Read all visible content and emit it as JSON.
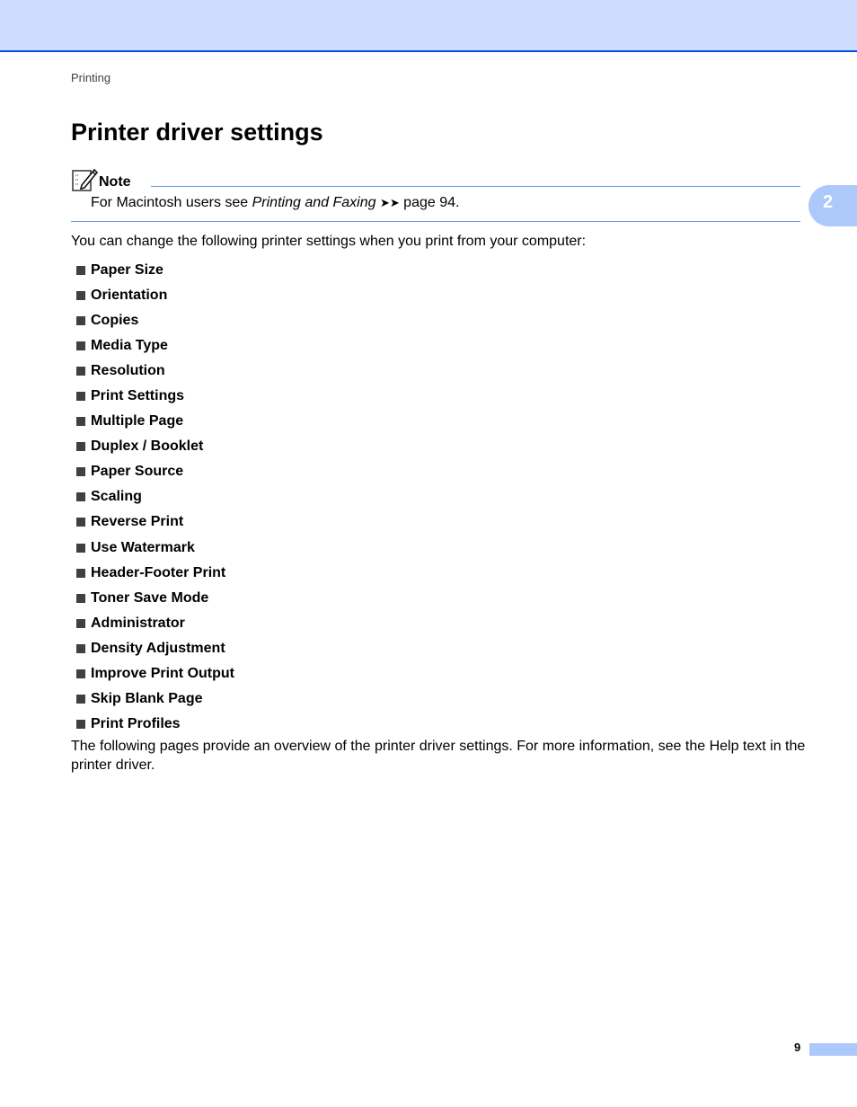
{
  "header": {
    "breadcrumb": "Printing"
  },
  "title": "Printer driver settings",
  "note": {
    "label": "Note",
    "text_before": "For Macintosh users see ",
    "link_text": "Printing and Faxing",
    "arrows": "➤➤",
    "text_after": " page 94."
  },
  "chapter_tab": "2",
  "intro": "You can change the following printer settings when you print from your computer:",
  "settings": [
    "Paper Size",
    "Orientation",
    "Copies",
    "Media Type",
    "Resolution",
    "Print Settings",
    "Multiple Page",
    "Duplex / Booklet",
    "Paper Source",
    "Scaling",
    "Reverse Print",
    "Use Watermark",
    "Header-Footer Print",
    "Toner Save Mode",
    "Administrator",
    "Density Adjustment",
    "Improve Print Output",
    "Skip Blank Page",
    "Print Profiles"
  ],
  "outro": "The following pages provide an overview of the printer driver settings. For more information, see the Help text in the printer driver.",
  "footer": {
    "page_number": "9"
  },
  "colors": {
    "band": "#cddcfd",
    "rule": "#0050e6",
    "accent": "#adc8fb"
  }
}
